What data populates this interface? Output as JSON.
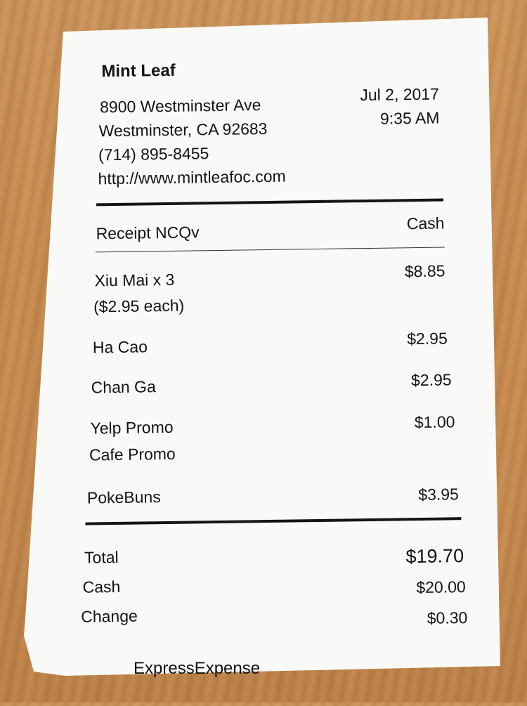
{
  "store": {
    "name": "Mint Leaf",
    "address_line1": "8900 Westminster Ave",
    "address_line2": "Westminster, CA 92683",
    "phone": "(714) 895-8455",
    "website": "http://www.mintleafoc.com"
  },
  "receipt_date": "Jul 2, 2017",
  "receipt_time": "9:35 AM",
  "receipt_id": "Receipt NCQv",
  "payment_type": "Cash",
  "items": [
    {
      "name": "Xiu Mai x 3",
      "detail": "($2.95 each)",
      "price": "$8.85"
    },
    {
      "name": "Ha Cao",
      "price": "$2.95"
    },
    {
      "name": "Chan Ga",
      "price": "$2.95"
    },
    {
      "name": "Yelp Promo",
      "detail": "Cafe Promo",
      "price": "$1.00"
    },
    {
      "name": "PokeBuns",
      "price": "$3.95"
    }
  ],
  "totals": {
    "total_label": "Total",
    "total_value": "$19.70",
    "cash_label": "Cash",
    "cash_value": "$20.00",
    "change_label": "Change",
    "change_value": "$0.30"
  },
  "watermark": "ExpressExpense"
}
